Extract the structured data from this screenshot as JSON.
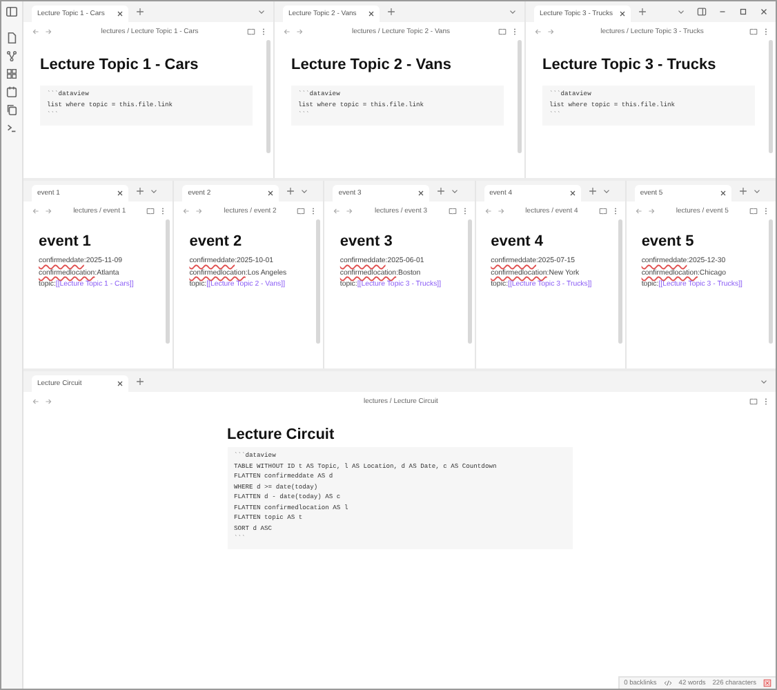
{
  "top_panes": [
    {
      "tab": "Lecture Topic 1 - Cars",
      "breadcrumb": "lectures / Lecture Topic 1 - Cars",
      "heading": "Lecture Topic 1 - Cars",
      "code": [
        "```dataview",
        "list where topic = this.file.link",
        "```"
      ]
    },
    {
      "tab": "Lecture Topic 2 - Vans",
      "breadcrumb": "lectures / Lecture Topic 2 - Vans",
      "heading": "Lecture Topic 2 - Vans",
      "code": [
        "```dataview",
        "list where topic = this.file.link",
        "```"
      ]
    },
    {
      "tab": "Lecture Topic 3 - Trucks",
      "breadcrumb": "lectures / Lecture Topic 3 - Trucks",
      "heading": "Lecture Topic 3 - Trucks",
      "code": [
        "```dataview",
        "list where topic = this.file.link",
        "```"
      ]
    }
  ],
  "event_panes": [
    {
      "tab": "event 1",
      "breadcrumb": "lectures / event 1",
      "heading": "event 1",
      "properties": [
        {
          "kind": "text",
          "key": "confirmeddate",
          "misspelled": true,
          "value": ":2025-11-09"
        },
        {
          "kind": "text",
          "key": "confirmedlocation",
          "misspelled": true,
          "value": ":Atlanta"
        },
        {
          "kind": "link",
          "key": "topic:",
          "misspelled": false,
          "value": "[[Lecture Topic 1 - Cars]]"
        }
      ]
    },
    {
      "tab": "event 2",
      "breadcrumb": "lectures / event 2",
      "heading": "event 2",
      "properties": [
        {
          "kind": "text",
          "key": "confirmeddate",
          "misspelled": true,
          "value": ":2025-10-01"
        },
        {
          "kind": "text",
          "key": "confirmedlocation",
          "misspelled": true,
          "value": ":Los Angeles"
        },
        {
          "kind": "link",
          "key": "topic:",
          "misspelled": false,
          "value": "[[Lecture Topic 2 - Vans]]"
        }
      ]
    },
    {
      "tab": "event 3",
      "breadcrumb": "lectures / event 3",
      "heading": "event 3",
      "properties": [
        {
          "kind": "text",
          "key": "confirmeddate",
          "misspelled": true,
          "value": ":2025-06-01"
        },
        {
          "kind": "text",
          "key": "confirmedlocation",
          "misspelled": true,
          "value": ":Boston"
        },
        {
          "kind": "link",
          "key": "topic:",
          "misspelled": false,
          "value": "[[Lecture Topic 3 - Trucks]]"
        }
      ]
    },
    {
      "tab": "event 4",
      "breadcrumb": "lectures / event 4",
      "heading": "event 4",
      "properties": [
        {
          "kind": "text",
          "key": "confirmeddate",
          "misspelled": true,
          "value": ":2025-07-15"
        },
        {
          "kind": "text",
          "key": "confirmedlocation",
          "misspelled": true,
          "value": ":New York"
        },
        {
          "kind": "link",
          "key": "topic:",
          "misspelled": false,
          "value": "[[Lecture Topic 3 - Trucks]]"
        }
      ]
    },
    {
      "tab": "event 5",
      "breadcrumb": "lectures / event 5",
      "heading": "event 5",
      "properties": [
        {
          "kind": "text",
          "key": "confirmeddate",
          "misspelled": true,
          "value": ":2025-12-30"
        },
        {
          "kind": "text",
          "key": "confirmedlocation",
          "misspelled": true,
          "value": ":Chicago"
        },
        {
          "kind": "link",
          "key": "topic:",
          "misspelled": false,
          "value": "[[Lecture Topic 3 - Trucks]]"
        }
      ]
    }
  ],
  "bottom_pane": {
    "tab": "Lecture Circuit",
    "breadcrumb": "lectures / Lecture Circuit",
    "heading": "Lecture Circuit",
    "code": [
      "```dataview",
      "TABLE WITHOUT ID t AS Topic, l AS Location, d AS Date, c AS Countdown",
      "FLATTEN confirmeddate AS d",
      "WHERE d >= date(today)",
      "FLATTEN d - date(today) AS c",
      "FLATTEN confirmedlocation AS l",
      "FLATTEN topic AS t",
      "SORT d ASC",
      "```"
    ]
  },
  "status_bar": {
    "backlinks": "0 backlinks",
    "words": "42 words",
    "characters": "226 characters"
  }
}
